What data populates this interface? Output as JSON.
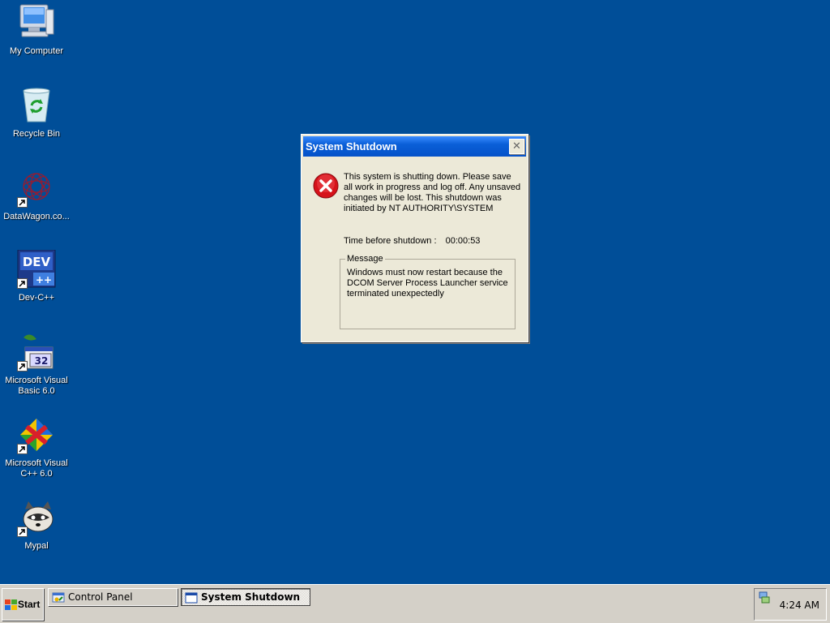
{
  "desktop": {
    "icons": [
      {
        "label": "My Computer",
        "icon": "my-computer-icon"
      },
      {
        "label": "Recycle Bin",
        "icon": "recycle-bin-icon"
      },
      {
        "label": "DataWagon.co...",
        "icon": "datawagon-icon"
      },
      {
        "label": "Dev-C++",
        "icon": "dev-cpp-icon",
        "badge": "DEV"
      },
      {
        "label": "Microsoft Visual Basic 6.0",
        "icon": "visual-basic-icon",
        "badge": "32"
      },
      {
        "label": "Microsoft Visual C++ 6.0",
        "icon": "visual-cpp-icon"
      },
      {
        "label": "Mypal",
        "icon": "mypal-raccoon-icon"
      }
    ]
  },
  "dialog": {
    "title": "System Shutdown",
    "message": "This system is shutting down. Please save all work in progress and log off. Any unsaved changes will be lost. This shutdown was initiated by NT AUTHORITY\\SYSTEM",
    "countdown_label": "Time before shutdown :",
    "countdown_value": "00:00:53",
    "group_label": "Message",
    "group_text": "Windows must now restart because the DCOM Server Process Launcher service terminated unexpectedly"
  },
  "taskbar": {
    "start_label": "Start",
    "tasks": [
      {
        "label": "Control Panel",
        "active": false
      },
      {
        "label": "System Shutdown",
        "active": true
      }
    ],
    "clock": "4:24 AM"
  },
  "colors": {
    "desktop": "#004e98",
    "titlebar": "#0a5fd8",
    "dialog_face": "#ece9d8",
    "taskbar": "#d4d0c8",
    "error_red": "#d6121a"
  }
}
